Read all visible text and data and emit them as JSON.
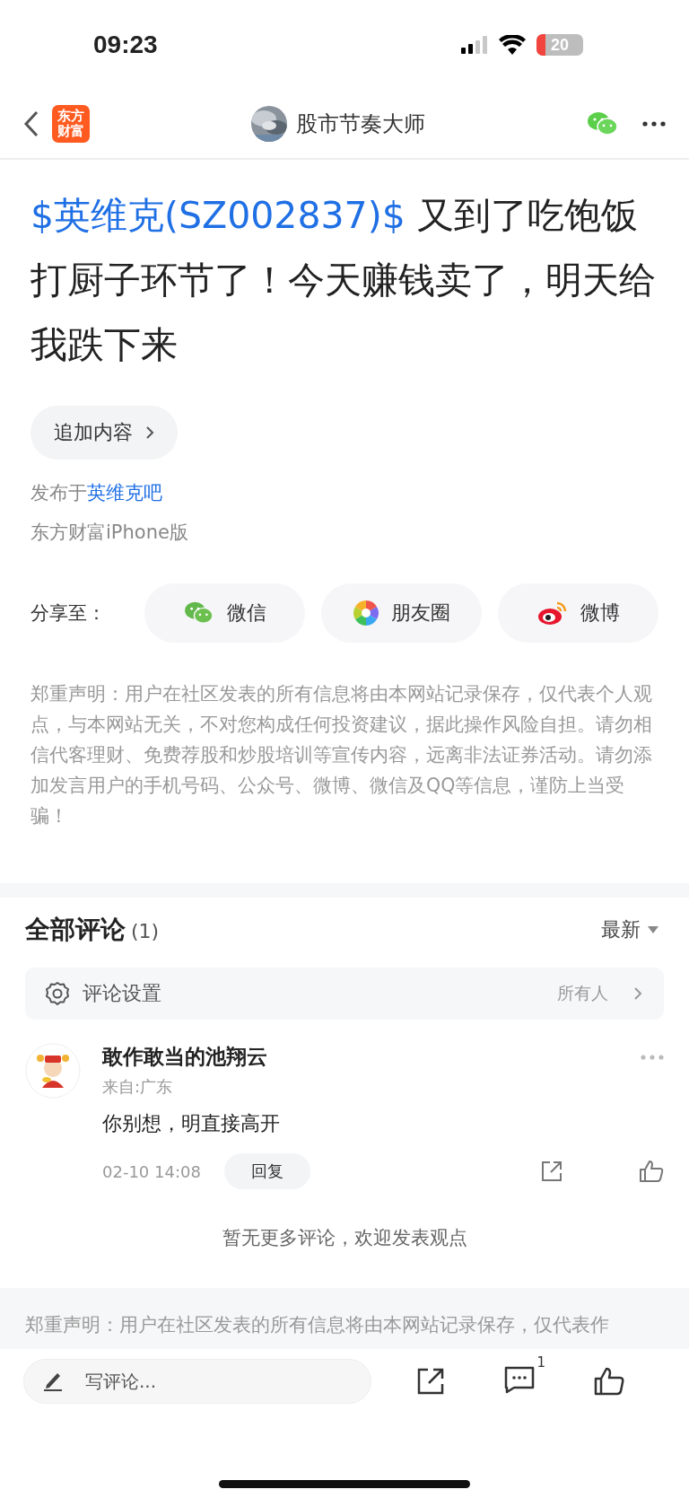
{
  "status_bar": {
    "time": "09:23",
    "battery": "20"
  },
  "nav": {
    "title": "股市节奏大师",
    "logo_lines": [
      "东方",
      "财富"
    ]
  },
  "post": {
    "stock_tag": "$英维克(SZ002837)$",
    "body": "  又到了吃饱饭打厨子环节了！今天赚钱卖了，明天给我跌下来",
    "append_button": "追加内容",
    "published_prefix": "发布于",
    "bar_name": "英维克吧",
    "source": "东方财富iPhone版"
  },
  "share": {
    "label": "分享至：",
    "targets": [
      {
        "kind": "wechat",
        "label": "微信"
      },
      {
        "kind": "moments",
        "label": "朋友圈"
      },
      {
        "kind": "weibo",
        "label": "微博"
      }
    ]
  },
  "disclaimer": "郑重声明：用户在社区发表的所有信息将由本网站记录保存，仅代表个人观点，与本网站无关，不对您构成任何投资建议，据此操作风险自担。请勿相信代客理财、免费荐股和炒股培训等宣传内容，远离非法证券活动。请勿添加发言用户的手机号码、公众号、微博、微信及QQ等信息，谨防上当受骗！",
  "comments": {
    "title": "全部评论",
    "count": "(1)",
    "sort": "最新",
    "settings_label": "评论设置",
    "settings_value": "所有人",
    "items": [
      {
        "author": "敢作敢当的池翔云",
        "location": "来自:广东",
        "text": "你别想，明直接高开",
        "time": "02-10 14:08",
        "reply": "回复"
      }
    ],
    "end_note": "暂无更多评论，欢迎发表观点"
  },
  "footer_disclaimer": "郑重声明：用户在社区发表的所有信息将由本网站记录保存，仅代表作",
  "bottom_bar": {
    "placeholder": "写评论...",
    "comment_count": "1"
  }
}
